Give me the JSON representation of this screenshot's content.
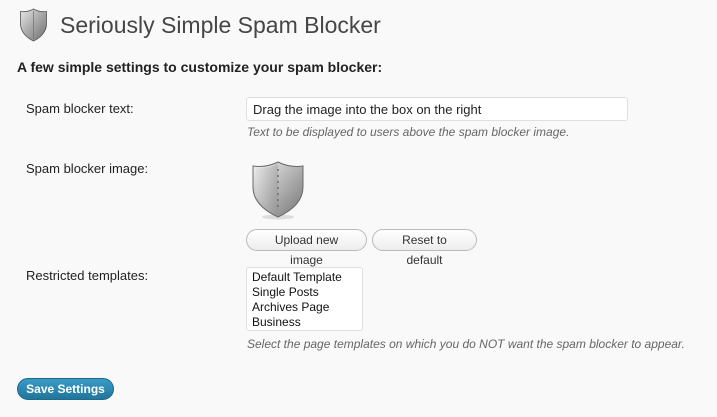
{
  "header": {
    "title": "Seriously Simple Spam Blocker",
    "icon": "shield-icon"
  },
  "settings": {
    "heading": "A few simple settings to customize your spam blocker:",
    "spam_text": {
      "label": "Spam blocker text:",
      "value": "Drag the image into the box on the right",
      "description": "Text to be displayed to users above the spam blocker image."
    },
    "spam_image": {
      "label": "Spam blocker image:",
      "image_icon": "shield-icon",
      "upload_label": "Upload new image",
      "reset_label": "Reset to default"
    },
    "templates": {
      "label": "Restricted templates:",
      "options": [
        "Default Template",
        "Single Posts",
        "Archives Page",
        "Business"
      ],
      "description": "Select the page templates on which you do NOT want the spam blocker to appear."
    }
  },
  "actions": {
    "save_label": "Save Settings"
  },
  "colors": {
    "primary_button": "#21759b",
    "background": "#f9f9f9"
  }
}
